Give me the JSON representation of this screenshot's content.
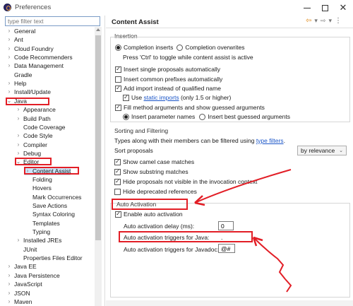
{
  "window": {
    "title": "Preferences"
  },
  "filter": {
    "placeholder": "type filter text"
  },
  "tree": [
    {
      "label": "General",
      "chevron": "›",
      "indent": 0
    },
    {
      "label": "Ant",
      "chevron": "›",
      "indent": 0
    },
    {
      "label": "Cloud Foundry",
      "chevron": "›",
      "indent": 0
    },
    {
      "label": "Code Recommenders",
      "chevron": "›",
      "indent": 0
    },
    {
      "label": "Data Management",
      "chevron": "›",
      "indent": 0
    },
    {
      "label": "Gradle",
      "chevron": "",
      "indent": 0
    },
    {
      "label": "Help",
      "chevron": "›",
      "indent": 0
    },
    {
      "label": "Install/Update",
      "chevron": "›",
      "indent": 0
    },
    {
      "label": "Java",
      "chevron": "⌄",
      "indent": 0
    },
    {
      "label": "Appearance",
      "chevron": "›",
      "indent": 1
    },
    {
      "label": "Build Path",
      "chevron": "›",
      "indent": 1
    },
    {
      "label": "Code Coverage",
      "chevron": "",
      "indent": 1
    },
    {
      "label": "Code Style",
      "chevron": "›",
      "indent": 1
    },
    {
      "label": "Compiler",
      "chevron": "›",
      "indent": 1
    },
    {
      "label": "Debug",
      "chevron": "›",
      "indent": 1
    },
    {
      "label": "Editor",
      "chevron": "⌄",
      "indent": 1
    },
    {
      "label": "Content Assist",
      "chevron": "›",
      "indent": 2
    },
    {
      "label": "Folding",
      "chevron": "",
      "indent": 2
    },
    {
      "label": "Hovers",
      "chevron": "",
      "indent": 2
    },
    {
      "label": "Mark Occurrences",
      "chevron": "",
      "indent": 2
    },
    {
      "label": "Save Actions",
      "chevron": "",
      "indent": 2
    },
    {
      "label": "Syntax Coloring",
      "chevron": "",
      "indent": 2
    },
    {
      "label": "Templates",
      "chevron": "",
      "indent": 2
    },
    {
      "label": "Typing",
      "chevron": "",
      "indent": 2
    },
    {
      "label": "Installed JREs",
      "chevron": "›",
      "indent": 1
    },
    {
      "label": "JUnit",
      "chevron": "",
      "indent": 1
    },
    {
      "label": "Properties Files Editor",
      "chevron": "",
      "indent": 1
    },
    {
      "label": "Java EE",
      "chevron": "›",
      "indent": 0
    },
    {
      "label": "Java Persistence",
      "chevron": "›",
      "indent": 0
    },
    {
      "label": "JavaScript",
      "chevron": "›",
      "indent": 0
    },
    {
      "label": "JSON",
      "chevron": "›",
      "indent": 0
    },
    {
      "label": "Maven",
      "chevron": "›",
      "indent": 0
    }
  ],
  "panel": {
    "title": "Content Assist",
    "insertion": {
      "label": "Insertion",
      "completion_inserts": "Completion inserts",
      "completion_overwrites": "Completion overwrites",
      "toggle_hint": "Press 'Ctrl' to toggle while content assist is active",
      "insert_single": "Insert single proposals automatically",
      "insert_common": "Insert common prefixes automatically",
      "add_import": "Add import instead of qualified name",
      "use_prefix": "Use",
      "static_imports": "static imports",
      "use_suffix": "(only 1.5 or higher)",
      "fill_args": "Fill method arguments and show guessed arguments",
      "insert_param_names": "Insert parameter names",
      "insert_best_guessed": "Insert best guessed arguments"
    },
    "sorting": {
      "label": "Sorting and Filtering",
      "types_prefix": "Types along with their members can be filtered using",
      "type_filters": "type filters",
      "types_suffix": ".",
      "sort_proposals": "Sort proposals",
      "sort_value": "by relevance",
      "show_camel": "Show camel case matches",
      "show_substring": "Show substring matches",
      "hide_not_visible": "Hide proposals not visible in the invocation context",
      "hide_deprecated": "Hide deprecated references"
    },
    "auto_activation": {
      "label": "Auto Activation",
      "enable": "Enable auto activation",
      "delay_label": "Auto activation delay (ms):",
      "delay_value": "0",
      "java_triggers_label": "Auto activation triggers for Java:",
      "java_triggers_value": ".",
      "javadoc_triggers_label": "Auto activation triggers for Javadoc:",
      "javadoc_triggers_value": "@#"
    }
  },
  "colors": {
    "annotation": "#e21e26",
    "link": "#1a55c8",
    "selection": "#cce4f7"
  }
}
